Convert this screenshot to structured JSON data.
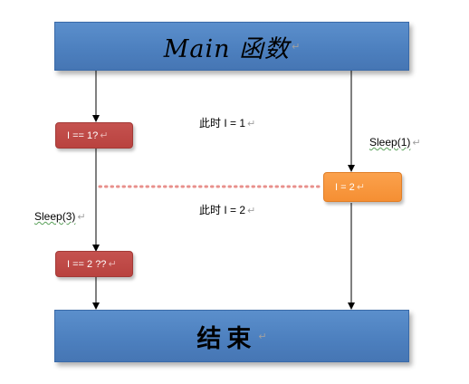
{
  "banners": {
    "top_title": "Main 函数",
    "bottom_title": "结束",
    "color": "#4f81bd"
  },
  "boxes": {
    "check1": "I == 1?",
    "check2": "I == 2 ??",
    "assign2": "I = 2",
    "red_color": "#c0504d",
    "orange_color": "#f79646"
  },
  "labels": {
    "state1": "此时 I = 1",
    "state2": "此时 I = 2",
    "sleep_right": "Sleep(1)",
    "sleep_left": "Sleep(3)"
  },
  "marks": {
    "paragraph_mark": "↵"
  }
}
